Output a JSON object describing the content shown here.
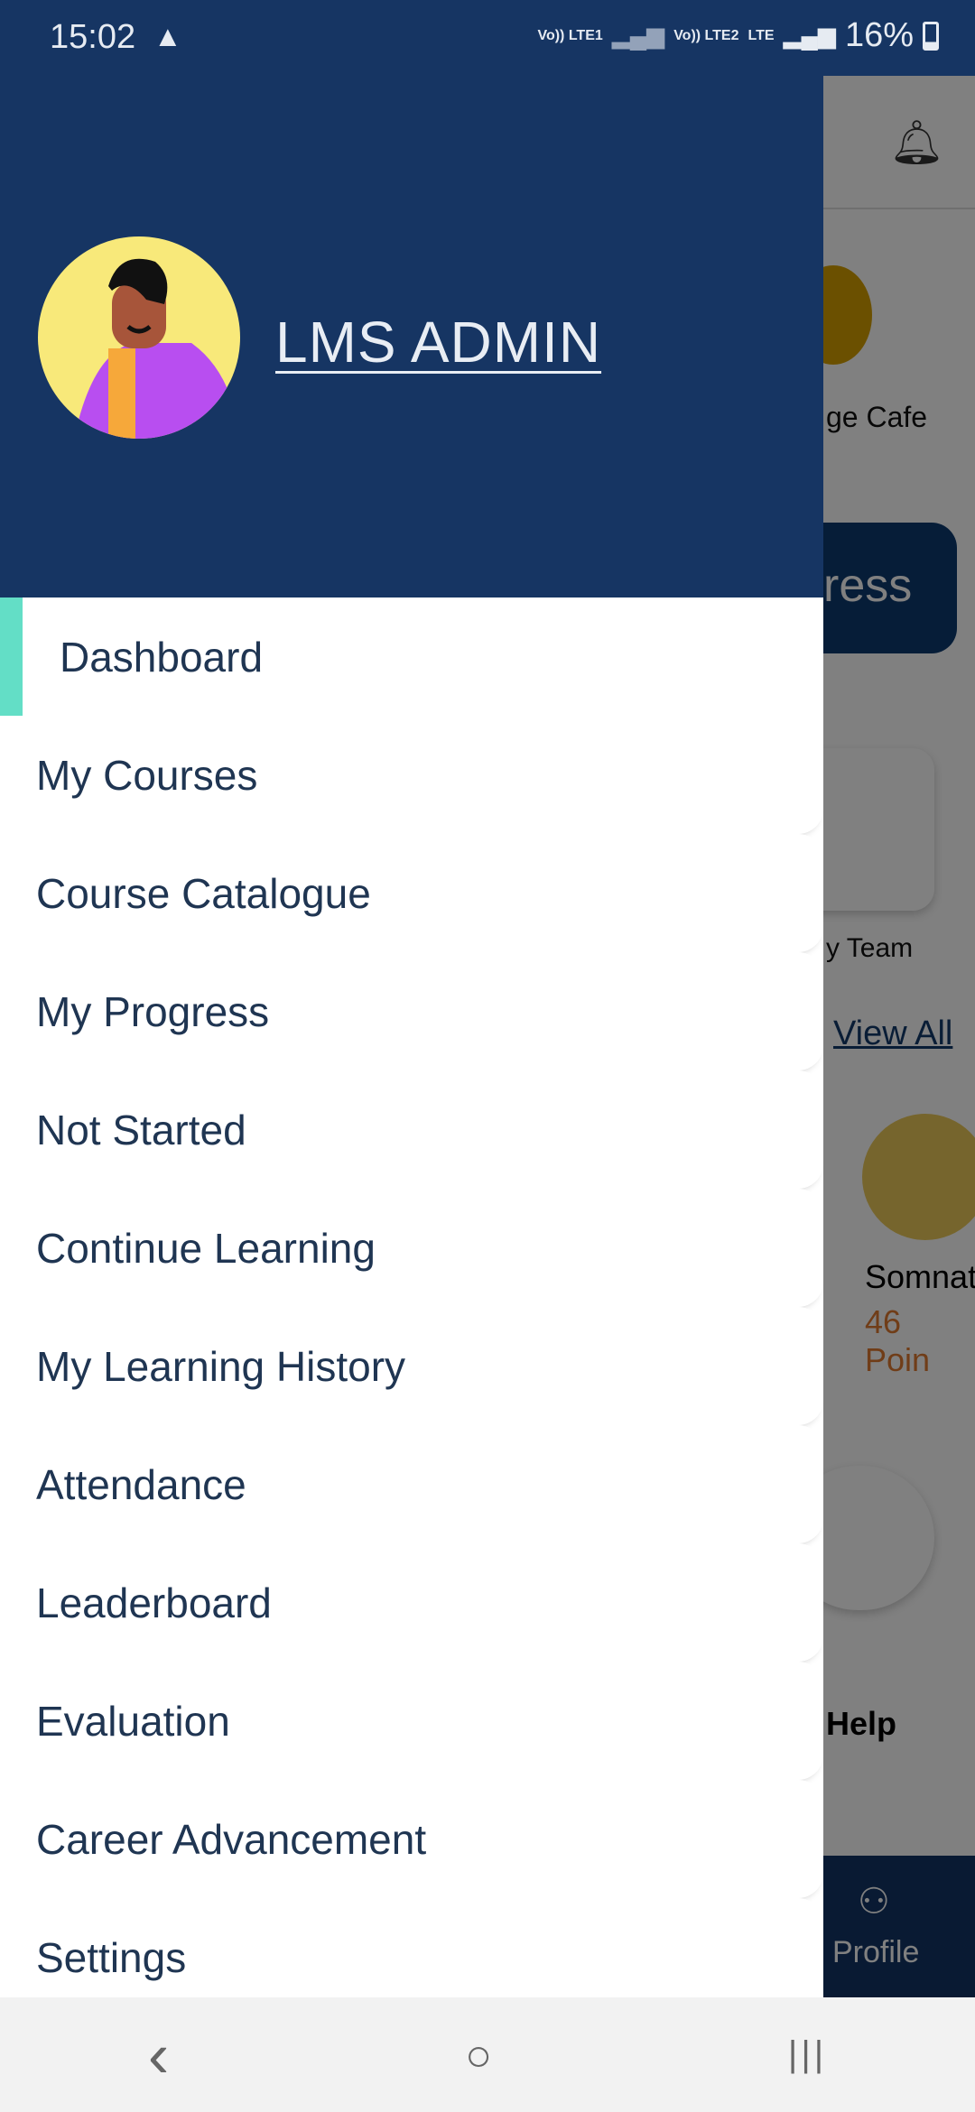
{
  "status_bar": {
    "time": "15:02",
    "warning_icon": "warning-triangle-icon",
    "sim1": "Vo)) LTE1",
    "sim2": "Vo)) LTE2",
    "network": "LTE",
    "battery": "16%"
  },
  "background_app": {
    "cafe_label": "ge Cafe",
    "progress_button": "ress",
    "team_label": "y Team",
    "view_all": "View All",
    "leader_name": "Somnat",
    "leader_points": "46 Poin",
    "help_label": "Help",
    "profile_label": "Profile"
  },
  "drawer": {
    "user_name": "LMS ADMIN",
    "header_color": "#163563",
    "active_indicator_color": "#63dec6",
    "items": [
      {
        "label": "Dashboard",
        "active": true
      },
      {
        "label": "My Courses"
      },
      {
        "label": "Course Catalogue"
      },
      {
        "label": "My Progress"
      },
      {
        "label": "Not Started"
      },
      {
        "label": "Continue Learning"
      },
      {
        "label": "My Learning History"
      },
      {
        "label": "Attendance"
      },
      {
        "label": "Leaderboard"
      },
      {
        "label": "Evaluation"
      },
      {
        "label": "Career Advancement"
      },
      {
        "label": "Settings"
      }
    ]
  },
  "nav_bar": {
    "back": "‹",
    "home": "○",
    "recents": "|||"
  }
}
